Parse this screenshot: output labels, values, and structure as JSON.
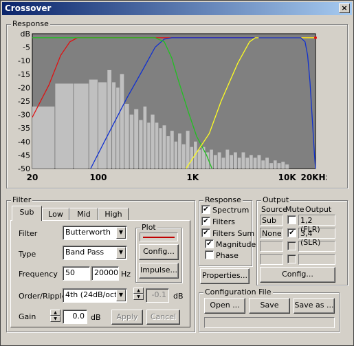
{
  "window": {
    "title": "Crossover",
    "close_glyph": "×"
  },
  "response_group": {
    "label": "Response"
  },
  "chart_data": {
    "type": "line",
    "x_scale": "log",
    "xlim": [
      20,
      20000
    ],
    "ylim": [
      -50,
      0
    ],
    "y_unit": "dB",
    "yticks": [
      -5,
      -10,
      -15,
      -20,
      -25,
      -30,
      -35,
      -40,
      -45,
      -50
    ],
    "xticks": [
      "20",
      "100",
      "1K",
      "10K",
      "20KHz"
    ],
    "x_tick_values": [
      20,
      100,
      1000,
      10000,
      20000
    ],
    "background": "#808080",
    "series": [
      {
        "color": "#e01010",
        "points": [
          [
            20,
            -31
          ],
          [
            30,
            -19
          ],
          [
            40,
            -8
          ],
          [
            50,
            -3
          ],
          [
            60,
            -1.5
          ],
          [
            80,
            -1.5
          ],
          [
            20000,
            -1.5
          ]
        ]
      },
      {
        "color": "#1030d0",
        "points": [
          [
            83,
            -50
          ],
          [
            120,
            -39
          ],
          [
            200,
            -24
          ],
          [
            300,
            -13
          ],
          [
            400,
            -5
          ],
          [
            500,
            -2
          ],
          [
            600,
            -1.5
          ],
          [
            5000,
            -1.5
          ]
        ]
      },
      {
        "color": "#20c020",
        "points": [
          [
            20,
            -1.5
          ],
          [
            400,
            -1.5
          ],
          [
            500,
            -3
          ],
          [
            600,
            -9
          ],
          [
            700,
            -17
          ],
          [
            900,
            -29
          ],
          [
            1100,
            -38
          ],
          [
            1400,
            -45
          ],
          [
            1600,
            -50
          ]
        ]
      },
      {
        "color": "#ffff20",
        "points": [
          [
            850,
            -50
          ],
          [
            1500,
            -37
          ],
          [
            2000,
            -25
          ],
          [
            3000,
            -11
          ],
          [
            4000,
            -3
          ],
          [
            4600,
            -1.5
          ],
          [
            20000,
            -1.5
          ]
        ]
      },
      {
        "color": "#1030d0",
        "points": [
          [
            5000,
            -1.5
          ],
          [
            14000,
            -1.5
          ],
          [
            15500,
            -3
          ],
          [
            16500,
            -8
          ],
          [
            17500,
            -18
          ],
          [
            18500,
            -32
          ],
          [
            19500,
            -45
          ],
          [
            20000,
            -50
          ]
        ]
      }
    ],
    "spectrum": [
      {
        "f1": 20,
        "f2": 35,
        "db": -27
      },
      {
        "f1": 35,
        "f2": 55,
        "db": -18.5
      },
      {
        "f1": 55,
        "f2": 80,
        "db": -18.5
      },
      {
        "f1": 80,
        "f2": 100,
        "db": -17
      },
      {
        "f1": 100,
        "f2": 125,
        "db": -18
      },
      {
        "f1": 125,
        "f2": 140,
        "db": -13.5
      },
      {
        "f1": 140,
        "f2": 155,
        "db": -18
      },
      {
        "f1": 155,
        "f2": 170,
        "db": -20
      },
      {
        "f1": 170,
        "f2": 190,
        "db": -15
      },
      {
        "f1": 190,
        "f2": 215,
        "db": -26
      },
      {
        "f1": 215,
        "f2": 240,
        "db": -30
      },
      {
        "f1": 240,
        "f2": 270,
        "db": -28
      },
      {
        "f1": 270,
        "f2": 300,
        "db": -32
      },
      {
        "f1": 300,
        "f2": 330,
        "db": -27
      },
      {
        "f1": 330,
        "f2": 360,
        "db": -33
      },
      {
        "f1": 360,
        "f2": 400,
        "db": -30
      },
      {
        "f1": 400,
        "f2": 440,
        "db": -33
      },
      {
        "f1": 440,
        "f2": 480,
        "db": -35
      },
      {
        "f1": 480,
        "f2": 530,
        "db": -34
      },
      {
        "f1": 530,
        "f2": 580,
        "db": -38
      },
      {
        "f1": 580,
        "f2": 640,
        "db": -36
      },
      {
        "f1": 640,
        "f2": 700,
        "db": -40
      },
      {
        "f1": 700,
        "f2": 770,
        "db": -37
      },
      {
        "f1": 770,
        "f2": 850,
        "db": -41
      },
      {
        "f1": 850,
        "f2": 940,
        "db": -36
      },
      {
        "f1": 940,
        "f2": 1030,
        "db": -42
      },
      {
        "f1": 1030,
        "f2": 1130,
        "db": -40
      },
      {
        "f1": 1130,
        "f2": 1250,
        "db": -43
      },
      {
        "f1": 1250,
        "f2": 1380,
        "db": -42
      },
      {
        "f1": 1380,
        "f2": 1520,
        "db": -44
      },
      {
        "f1": 1520,
        "f2": 1670,
        "db": -43
      },
      {
        "f1": 1670,
        "f2": 1840,
        "db": -45
      },
      {
        "f1": 1840,
        "f2": 2030,
        "db": -44
      },
      {
        "f1": 2030,
        "f2": 2240,
        "db": -46
      },
      {
        "f1": 2240,
        "f2": 2470,
        "db": -43
      },
      {
        "f1": 2470,
        "f2": 2720,
        "db": -45
      },
      {
        "f1": 2720,
        "f2": 3000,
        "db": -44
      },
      {
        "f1": 3000,
        "f2": 3300,
        "db": -46
      },
      {
        "f1": 3300,
        "f2": 3640,
        "db": -44
      },
      {
        "f1": 3640,
        "f2": 4000,
        "db": -46
      },
      {
        "f1": 4000,
        "f2": 4400,
        "db": -45
      },
      {
        "f1": 4400,
        "f2": 4850,
        "db": -46
      },
      {
        "f1": 4850,
        "f2": 5350,
        "db": -45
      },
      {
        "f1": 5350,
        "f2": 5900,
        "db": -47
      },
      {
        "f1": 5900,
        "f2": 6500,
        "db": -46
      },
      {
        "f1": 6500,
        "f2": 7200,
        "db": -48
      },
      {
        "f1": 7200,
        "f2": 7900,
        "db": -47
      },
      {
        "f1": 7900,
        "f2": 8700,
        "db": -48
      },
      {
        "f1": 8700,
        "f2": 9600,
        "db": -47.5
      },
      {
        "f1": 9600,
        "f2": 10600,
        "db": -48.5
      }
    ]
  },
  "filter_group": {
    "label": "Filter",
    "tabs": [
      "Sub",
      "Low",
      "Mid",
      "High"
    ],
    "filter_label": "Filter",
    "filter_value": "Butterworth",
    "type_label": "Type",
    "type_value": "Band Pass",
    "frequency_label": "Frequency",
    "freq_low": "50",
    "freq_high": "20000",
    "freq_unit": "Hz",
    "order_label": "Order/Ripple",
    "order_value": "4th (24dB/oct)",
    "ripple_value": "-0.1",
    "ripple_unit": "dB",
    "gain_label": "Gain",
    "gain_value": "0.0",
    "gain_unit": "dB",
    "apply_label": "Apply",
    "cancel_label": "Cancel",
    "plot_label": "Plot",
    "plot_color": "#c00000",
    "config_label": "Config...",
    "impulse_label": "Impulse..."
  },
  "response_options": {
    "label": "Response",
    "spectrum": "Spectrum",
    "filters": "Filters",
    "filters_sum": "Filters Sum",
    "magnitude": "Magnitude",
    "phase": "Phase",
    "check_glyph": "✔",
    "properties_label": "Properties..."
  },
  "output_group": {
    "label": "Output",
    "col_source": "Source",
    "col_mute": "Mute",
    "col_output": "Output",
    "row1_source": "Sub",
    "row1_output": "1,2 (FLR)",
    "row2_source": "None",
    "row2_output": "3,4 (SLR)",
    "config_label": "Config..."
  },
  "config_file": {
    "label": "Configuration File",
    "open_label": "Open ...",
    "save_label": "Save",
    "saveas_label": "Save as ..."
  }
}
